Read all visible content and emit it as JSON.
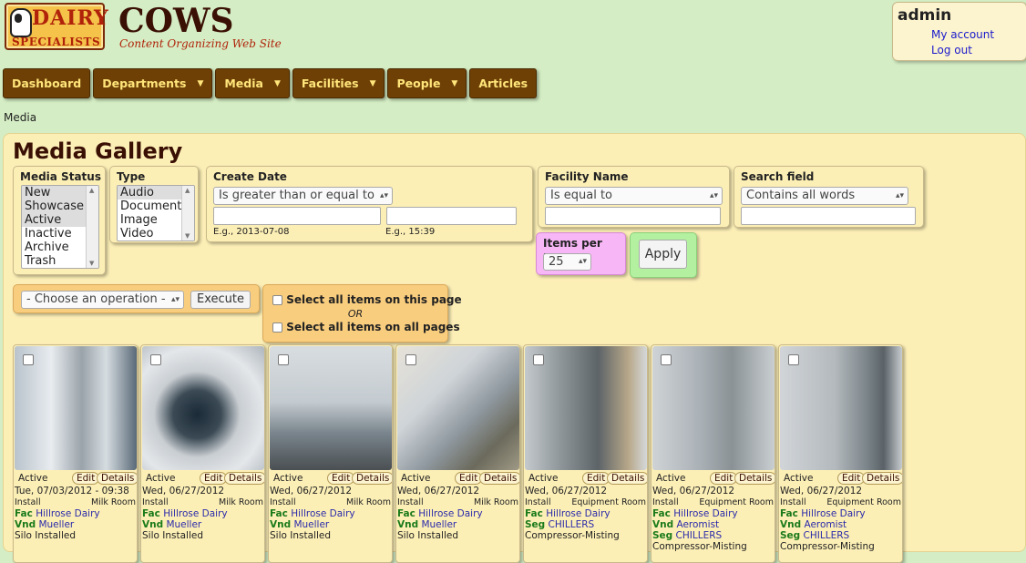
{
  "header": {
    "logo_word1": "DAIRY",
    "logo_word2": "SPECIALISTS",
    "title": "COWS",
    "subtitle": "Content Organizing Web Site"
  },
  "user": {
    "name": "admin",
    "my_account": "My account",
    "logout": "Log out"
  },
  "nav": {
    "dashboard": "Dashboard",
    "departments": "Departments",
    "media": "Media",
    "facilities": "Facilities",
    "people": "People",
    "articles": "Articles"
  },
  "breadcrumb": "Media",
  "page_title": "Media Gallery",
  "filters": {
    "media_status": {
      "label": "Media Status",
      "options": [
        "New",
        "Showcase",
        "Active",
        "Inactive",
        "Archive",
        "Trash"
      ]
    },
    "type": {
      "label": "Type",
      "options": [
        "Audio",
        "Document",
        "Image",
        "Video"
      ]
    },
    "create_date": {
      "label": "Create Date",
      "operator": "Is greater than or equal to",
      "date_hint": "E.g., 2013-07-08",
      "time_hint": "E.g., 15:39"
    },
    "facility_name": {
      "label": "Facility Name",
      "operator": "Is equal to"
    },
    "search_field": {
      "label": "Search field",
      "operator": "Contains all words"
    },
    "items_per_page": {
      "label": "Items per page",
      "value": "25"
    },
    "apply_label": "Apply"
  },
  "bulk": {
    "operation_placeholder": "- Choose an operation -",
    "execute_label": "Execute",
    "select_page_label": "Select all items on this page",
    "or_label": "OR",
    "select_all_label": "Select all items on all pages"
  },
  "cards": [
    {
      "status": "Active",
      "edit": "Edit",
      "details": "Details",
      "date": "Tue, 07/03/2012 - 09:38",
      "category": "Install",
      "room": "Milk Room",
      "row1_key": "Fac",
      "row1_val": "Hillrose Dairy",
      "row2_key": "Vnd",
      "row2_val": "Mueller",
      "note": "Silo Installed"
    },
    {
      "status": "Active",
      "edit": "Edit",
      "details": "Details",
      "date": "Wed, 06/27/2012",
      "category": "Install",
      "room": "Milk Room",
      "row1_key": "Fac",
      "row1_val": "Hillrose Dairy",
      "row2_key": "Vnd",
      "row2_val": "Mueller",
      "note": "Silo Installed"
    },
    {
      "status": "Active",
      "edit": "Edit",
      "details": "Details",
      "date": "Wed, 06/27/2012",
      "category": "Install",
      "room": "Milk Room",
      "row1_key": "Fac",
      "row1_val": "Hillrose Dairy",
      "row2_key": "Vnd",
      "row2_val": "Mueller",
      "note": "Silo Installed"
    },
    {
      "status": "Active",
      "edit": "Edit",
      "details": "Details",
      "date": "Wed, 06/27/2012",
      "category": "Install",
      "room": "Milk Room",
      "row1_key": "Fac",
      "row1_val": "Hillrose Dairy",
      "row2_key": "Vnd",
      "row2_val": "Mueller",
      "note": "Silo Installed"
    },
    {
      "status": "Active",
      "edit": "Edit",
      "details": "Details",
      "date": "Wed, 06/27/2012",
      "category": "Install",
      "room": "Equipment Room",
      "row1_key": "Fac",
      "row1_val": "Hillrose Dairy",
      "row2_key": "Seg",
      "row2_val": "CHILLERS",
      "note": "Compressor-Misting"
    },
    {
      "status": "Active",
      "edit": "Edit",
      "details": "Details",
      "date": "Wed, 06/27/2012",
      "category": "Install",
      "room": "Equipment Room",
      "row1_key": "Fac",
      "row1_val": "Hillrose Dairy",
      "row2_key": "Vnd",
      "row2_val": "Aeromist",
      "row3_key": "Seg",
      "row3_val": "CHILLERS",
      "note": "Compressor-Misting"
    },
    {
      "status": "Active",
      "edit": "Edit",
      "details": "Details",
      "date": "Wed, 06/27/2012",
      "category": "Install",
      "room": "Equipment Room",
      "row1_key": "Fac",
      "row1_val": "Hillrose Dairy",
      "row2_key": "Vnd",
      "row2_val": "Aeromist",
      "row3_key": "Seg",
      "row3_val": "CHILLERS",
      "note": "Compressor-Misting"
    }
  ]
}
